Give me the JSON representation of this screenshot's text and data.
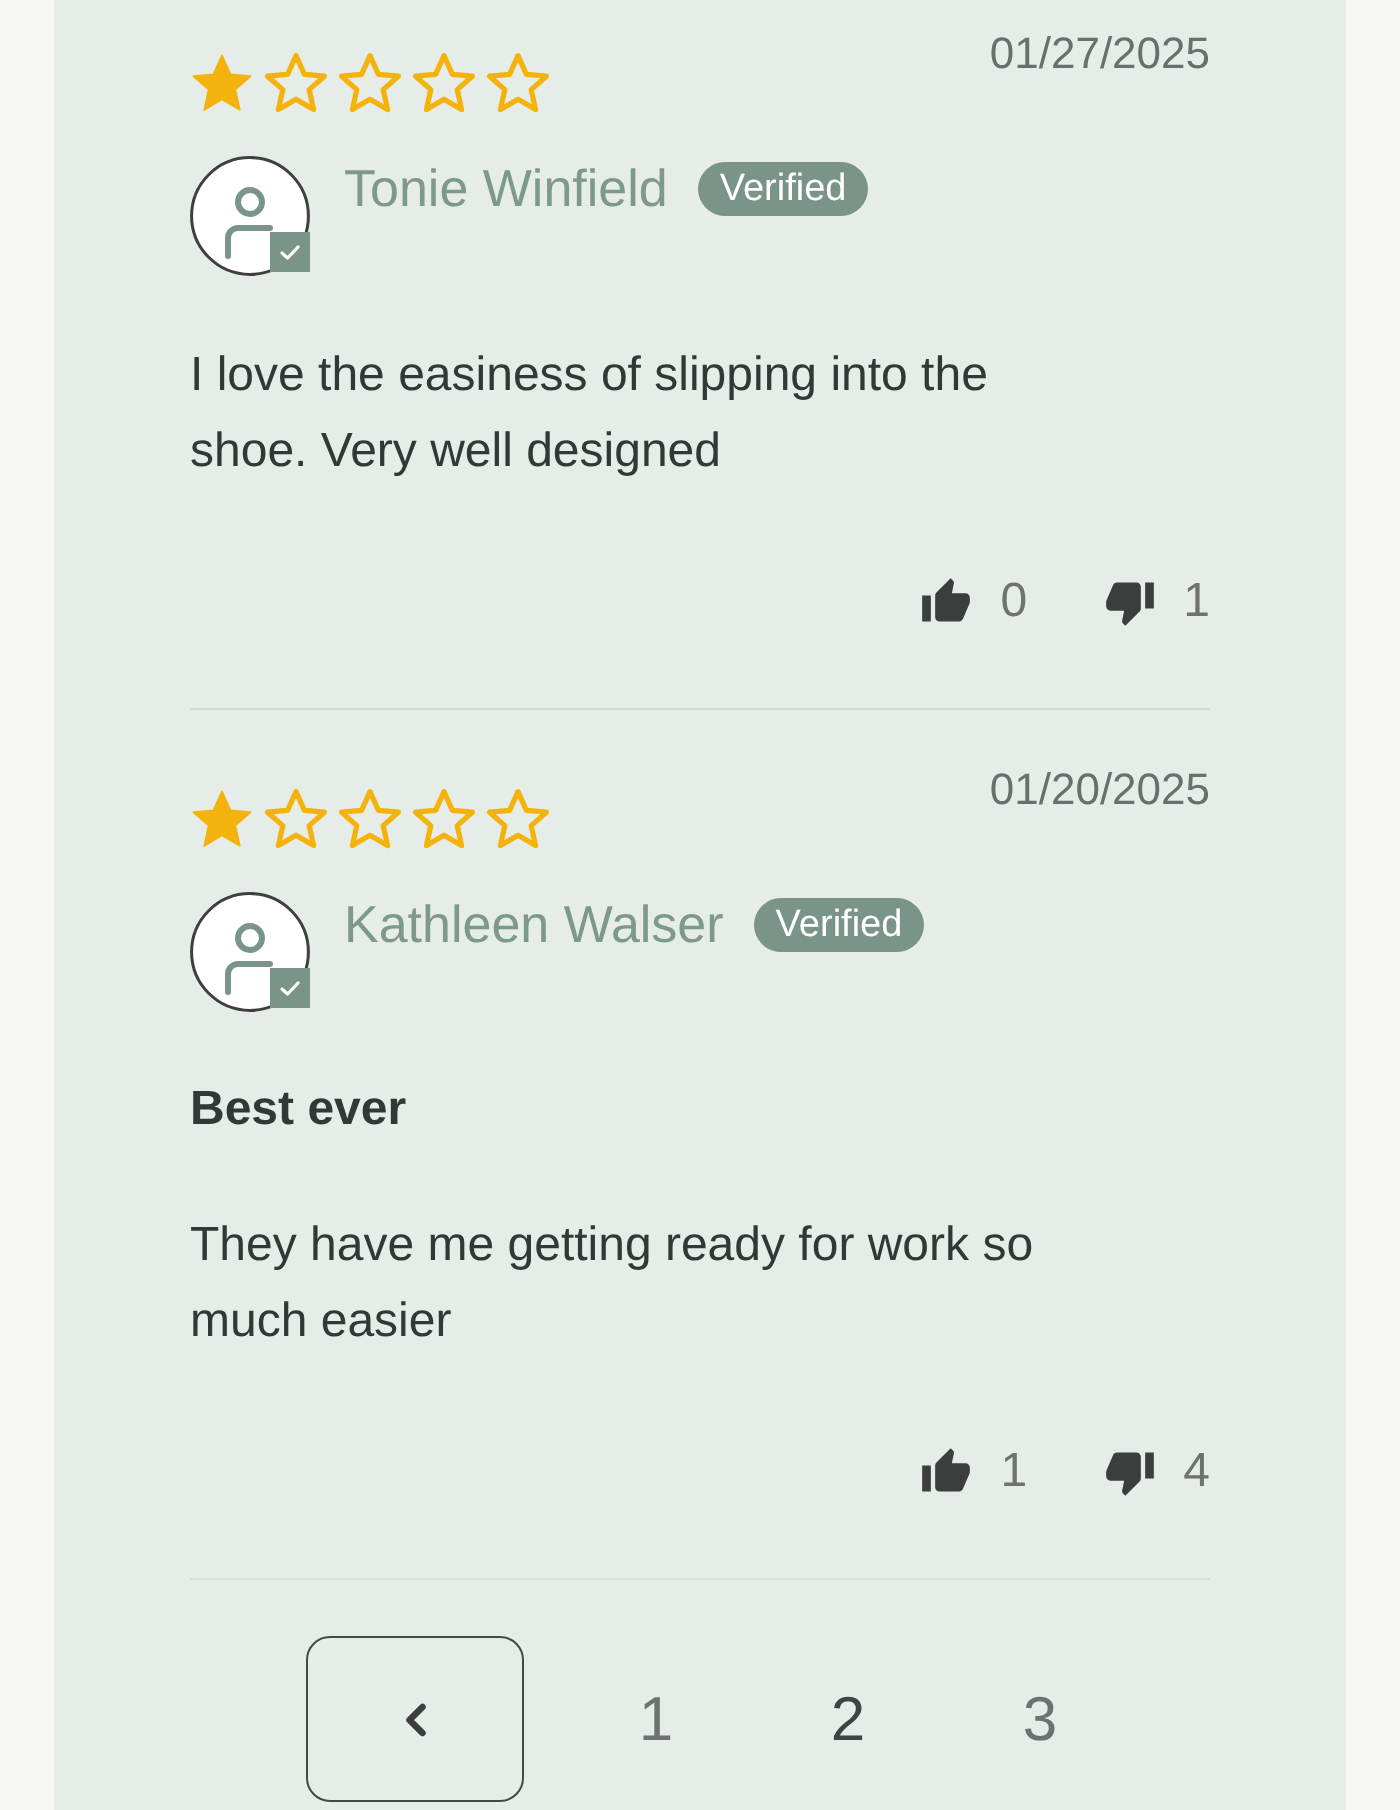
{
  "reviews": [
    {
      "stars": 1,
      "date": "01/27/2025",
      "author": "Tonie Winfield",
      "badge": "Verified",
      "verified": true,
      "body": "I love the easiness of slipping into the shoe. Very well designed",
      "helpful": "0",
      "unhelpful": "1"
    },
    {
      "stars": 1,
      "date": "01/20/2025",
      "author": "Kathleen Walser",
      "badge": "Verified",
      "verified": true,
      "title": "Best ever",
      "body": "They have me getting ready for work so much easier",
      "helpful": "1",
      "unhelpful": "4"
    }
  ],
  "pagination": {
    "pages": [
      {
        "label": "1",
        "selected": false
      },
      {
        "label": "2",
        "selected": true
      },
      {
        "label": "3",
        "selected": false
      }
    ]
  }
}
